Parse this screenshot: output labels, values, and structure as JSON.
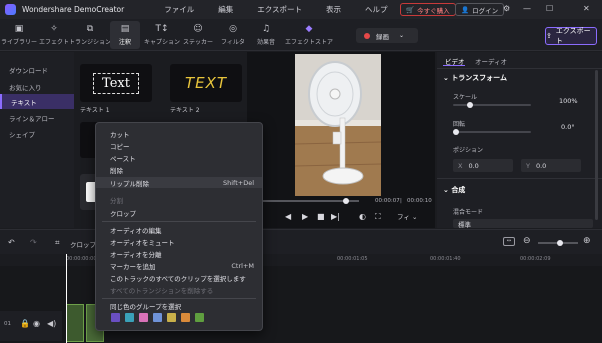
{
  "app": {
    "title": "Wondershare DemoCreator"
  },
  "menu": [
    "ファイル",
    "編集",
    "エクスポート",
    "表示",
    "ヘルプ"
  ],
  "header_buttons": {
    "buy": "今すぐ購入",
    "login": "ログイン"
  },
  "toolbar": {
    "items": [
      {
        "label": "ライブラリー",
        "icon": "folder-icon"
      },
      {
        "label": "エフェクト",
        "icon": "effect-icon"
      },
      {
        "label": "トランジション",
        "icon": "transition-icon"
      },
      {
        "label": "注釈",
        "icon": "annotation-icon"
      },
      {
        "label": "キャプション",
        "icon": "caption-icon"
      },
      {
        "label": "ステッカー",
        "icon": "sticker-icon"
      },
      {
        "label": "フィルタ",
        "icon": "filter-icon"
      },
      {
        "label": "効果音",
        "icon": "sound-effect-icon"
      },
      {
        "label": "エフェクトストア",
        "icon": "store-icon"
      }
    ],
    "record": "録画",
    "export": "エクスポート"
  },
  "categories": [
    "ダウンロード",
    "お気に入り",
    "テキスト",
    "ライン＆アロー",
    "シェイプ"
  ],
  "thumbnails": [
    {
      "preview": "Text",
      "label": "テキスト 1"
    },
    {
      "preview": "TEXT",
      "label": "テキスト 2"
    }
  ],
  "preview": {
    "time_current": "00:00:07",
    "time_total": "00:00:10",
    "fit": "フィ"
  },
  "properties": {
    "tabs": [
      "ビデオ",
      "オーディオ"
    ],
    "transform": "トランスフォーム",
    "scale_label": "スケール",
    "scale_value": "100%",
    "rotate_label": "回転",
    "rotate_value": "0.0°",
    "position_label": "ポジション",
    "pos_x_label": "X",
    "pos_x": "0.0",
    "pos_y_label": "Y",
    "pos_y": "0.0",
    "composite": "合成",
    "blend_label": "混合モード",
    "blend_value": "標準"
  },
  "timeline": {
    "crop": "クロップ",
    "ticks": [
      "00:00:00:00",
      "00:00:01:05",
      "00:00:01:40",
      "00:00:02:09"
    ]
  },
  "context_menu": {
    "items": [
      {
        "label": "カット",
        "shortcut": "",
        "disabled": false
      },
      {
        "label": "コピー",
        "shortcut": "",
        "disabled": false
      },
      {
        "label": "ペースト",
        "shortcut": "",
        "disabled": false
      },
      {
        "label": "削除",
        "shortcut": "",
        "disabled": false
      },
      {
        "label": "リップル削除",
        "shortcut": "Shift+Del",
        "disabled": false
      },
      {
        "label": "分割",
        "shortcut": "",
        "disabled": true
      },
      {
        "label": "クロップ",
        "shortcut": "",
        "disabled": false
      },
      {
        "label": "オーディオの編集",
        "shortcut": "",
        "disabled": false
      },
      {
        "label": "オーディオをミュート",
        "shortcut": "",
        "disabled": false
      },
      {
        "label": "オーディオを分離",
        "shortcut": "",
        "disabled": false
      },
      {
        "label": "マーカーを追加",
        "shortcut": "Ctrl+M",
        "disabled": false
      },
      {
        "label": "このトラックのすべてのクリップを選択します",
        "shortcut": "",
        "disabled": false
      },
      {
        "label": "すべてのトランジションを削除する",
        "shortcut": "",
        "disabled": true
      },
      {
        "label": "同じ色のグループを選択",
        "shortcut": "",
        "disabled": false
      }
    ],
    "colors": [
      "#6a4fc2",
      "#3aa1b8",
      "#d972b8",
      "#6f93d8",
      "#c8b04a",
      "#d98a3a",
      "#5f9e3f"
    ]
  }
}
